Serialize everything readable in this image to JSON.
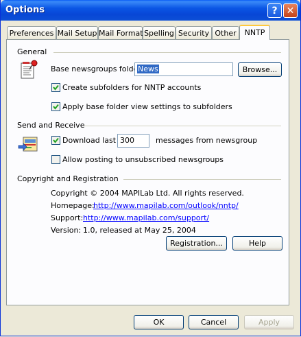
{
  "window": {
    "title": "Options"
  },
  "tabs": [
    {
      "label": "Preferences"
    },
    {
      "label": "Mail Setup"
    },
    {
      "label": "Mail Format"
    },
    {
      "label": "Spelling"
    },
    {
      "label": "Security"
    },
    {
      "label": "Other"
    },
    {
      "label": "NNTP"
    }
  ],
  "general": {
    "heading": "General",
    "folder_label": "Base newsgroups folder",
    "folder_value": "News",
    "browse_label": "Browse...",
    "create_subfolders": {
      "label": "Create subfolders for NNTP accounts",
      "checked": true
    },
    "apply_view": {
      "label": "Apply base folder view settings to subfolders",
      "checked": true
    }
  },
  "send_receive": {
    "heading": "Send and Receive",
    "download_label": "Download last",
    "download_checked": true,
    "download_value": "300",
    "download_suffix": "messages from newsgroup",
    "allow_posting": {
      "label": "Allow posting to unsubscribed newsgroups",
      "checked": false
    }
  },
  "copyright": {
    "heading": "Copyright and Registration",
    "text": "Copyright © 2004 MAPILab Ltd. All rights reserved.",
    "homepage_label": "Homepage:",
    "homepage_url": "http://www.mapilab.com/outlook/nntp/",
    "support_label": "Support:",
    "support_url": "http://www.mapilab.com/support/",
    "version_label": "Version:",
    "version_value": "1.0, released at May 25, 2004",
    "registration_label": "Registration...",
    "help_label": "Help"
  },
  "footer": {
    "ok_label": "OK",
    "cancel_label": "Cancel",
    "apply_label": "Apply"
  }
}
